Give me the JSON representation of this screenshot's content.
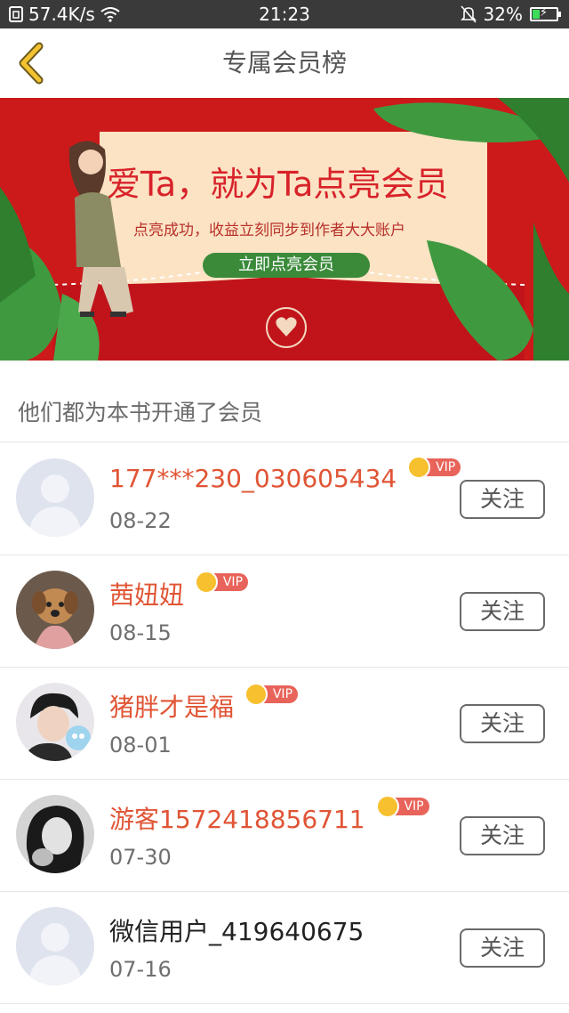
{
  "status_bar": {
    "speed": "57.4K/s",
    "time": "21:23",
    "battery": "32%",
    "battery_level": 0.32
  },
  "header": {
    "title": "专属会员榜"
  },
  "banner": {
    "headline": "爱Ta，就为Ta点亮会员",
    "subtitle": "点亮成功，收益立刻同步到作者大大账户",
    "button_label": "立即点亮会员"
  },
  "section": {
    "title": "他们都为本书开通了会员"
  },
  "vip_label": "VIP",
  "members": [
    {
      "name": "177***230_030605434",
      "date": "08-22",
      "vip": true,
      "follow_label": "关注",
      "avatar": "default-avatar"
    },
    {
      "name": "茜妞妞",
      "date": "08-15",
      "vip": true,
      "follow_label": "关注",
      "avatar": "puppy-photo"
    },
    {
      "name": "猪胖才是福",
      "date": "08-01",
      "vip": true,
      "follow_label": "关注",
      "avatar": "boy-photo"
    },
    {
      "name": "游客1572418856711",
      "date": "07-30",
      "vip": true,
      "follow_label": "关注",
      "avatar": "girl-photo"
    },
    {
      "name": "微信用户_419640675",
      "date": "07-16",
      "vip": false,
      "follow_label": "关注",
      "avatar": "default-avatar"
    }
  ],
  "colors": {
    "status_bar_bg": "#3a3a3a",
    "accent_red": "#e05535",
    "back_arrow": "#f2c230",
    "banner_red": "#cc1a1a",
    "banner_button_green": "#3a8a3a"
  }
}
